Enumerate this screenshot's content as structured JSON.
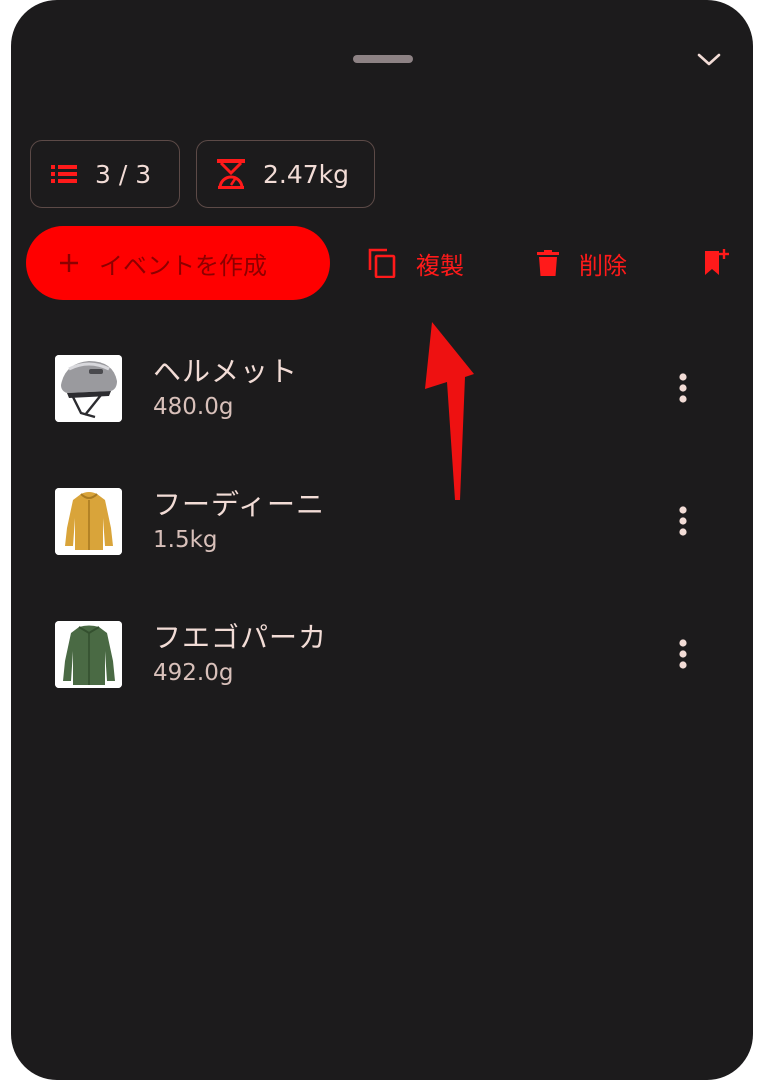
{
  "summary": {
    "item_count": "3 / 3",
    "total_weight": "2.47kg"
  },
  "actions": {
    "create_event_label": "イベントを作成",
    "duplicate_label": "複製",
    "delete_label": "削除"
  },
  "items": [
    {
      "name": "ヘルメット",
      "weight": "480.0g",
      "thumb": "helmet"
    },
    {
      "name": "フーディーニ",
      "weight": "1.5kg",
      "thumb": "yellow-jacket"
    },
    {
      "name": "フエゴパーカ",
      "weight": "492.0g",
      "thumb": "green-jacket"
    }
  ],
  "colors": {
    "background": "#1c1b1c",
    "accent": "#ff0000",
    "text": "#f2dcd6",
    "handle": "#8d8284"
  }
}
